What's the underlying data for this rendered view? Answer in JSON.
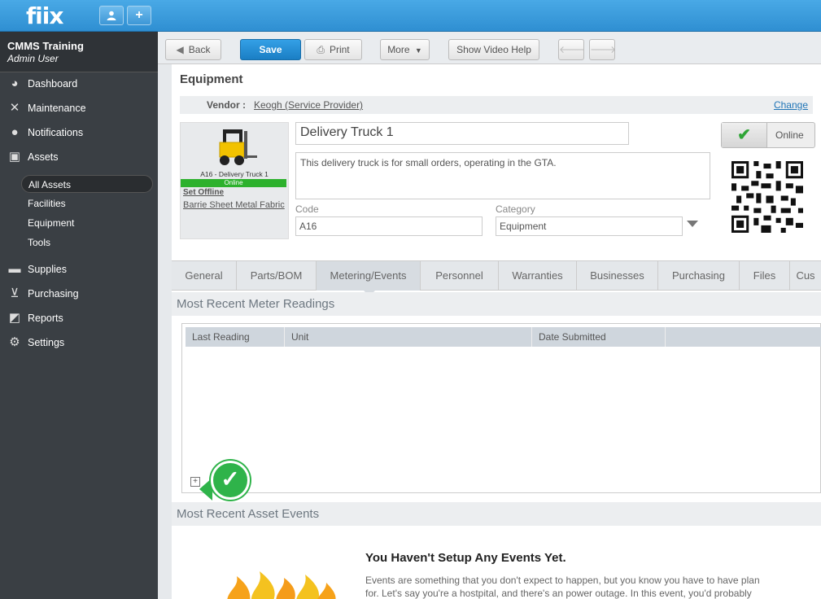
{
  "app": {
    "logo": "fiix",
    "topbar_buttons": [
      {
        "icon": "user-icon",
        "glyph": "👤"
      },
      {
        "icon": "plus-icon",
        "glyph": "+"
      }
    ]
  },
  "sidebar": {
    "org_name": "CMMS Training",
    "user_role": "Admin User",
    "items": [
      {
        "label": "Dashboard",
        "icon": "dashboard-icon"
      },
      {
        "label": "Maintenance",
        "icon": "tools-icon"
      },
      {
        "label": "Notifications",
        "icon": "speech-bubble-icon"
      },
      {
        "label": "Assets",
        "icon": "boxes-icon"
      },
      {
        "label": "Supplies",
        "icon": "truck-icon"
      },
      {
        "label": "Purchasing",
        "icon": "cart-icon"
      },
      {
        "label": "Reports",
        "icon": "chart-icon"
      },
      {
        "label": "Settings",
        "icon": "gear-icon"
      }
    ],
    "asset_subitems": [
      "All Assets",
      "Facilities",
      "Equipment",
      "Tools"
    ]
  },
  "toolbar": {
    "back_label": "Back",
    "save_label": "Save",
    "print_label": "Print",
    "more_label": "More",
    "video_label": "Show Video Help"
  },
  "record": {
    "section_title": "Equipment",
    "vendor_label": "Vendor :",
    "vendor_value": "Keogh (Service Provider)",
    "change_label": "Change",
    "asset_caption": "A16 - Delivery Truck 1",
    "online_strip": "Online",
    "set_offline": "Set Offline",
    "location": "Barrie Sheet Metal Fabric",
    "name": "Delivery Truck 1",
    "description": "This delivery truck is for small orders, operating in the GTA.",
    "code_label": "Code",
    "code_value": "A16",
    "category_label": "Category",
    "category_value": "Equipment",
    "status_label": "Online",
    "status_color": "#2fa536"
  },
  "tabs": [
    "General",
    "Parts/BOM",
    "Metering/Events",
    "Personnel",
    "Warranties",
    "Businesses",
    "Purchasing",
    "Files",
    "Cus"
  ],
  "active_tab": "Metering/Events",
  "meter_readings": {
    "title": "Most Recent Meter Readings",
    "columns": [
      "Last Reading",
      "Unit",
      "Date Submitted",
      ""
    ]
  },
  "asset_events": {
    "title": "Most Recent Asset Events",
    "empty_title": "You Haven't Setup Any Events Yet.",
    "empty_text": "Events are something that you don't expect to happen, but you know you have to have plan for. Let's say you're a hostpital, and there's an power outage. In this event, you'd probably"
  }
}
